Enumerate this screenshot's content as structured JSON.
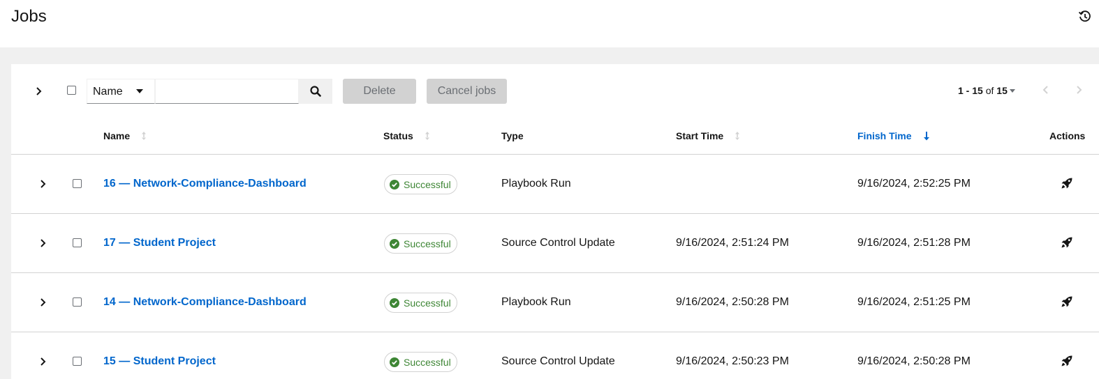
{
  "header": {
    "title": "Jobs",
    "history_icon": "history-icon"
  },
  "toolbar": {
    "filter_select_value": "Name",
    "search_placeholder": "",
    "delete_label": "Delete",
    "cancel_label": "Cancel jobs",
    "pagination": {
      "range": "1 - 15",
      "of_label": "of",
      "total": "15"
    }
  },
  "table": {
    "columns": {
      "name": "Name",
      "status": "Status",
      "type": "Type",
      "start": "Start Time",
      "finish": "Finish Time",
      "actions": "Actions"
    },
    "sorted_column": "Finish Time",
    "sort_direction": "descending",
    "rows": [
      {
        "name": "16 — Network-Compliance-Dashboard",
        "status": "Successful",
        "type": "Playbook Run",
        "start": "",
        "finish": "9/16/2024, 2:52:25 PM"
      },
      {
        "name": "17 — Student Project",
        "status": "Successful",
        "type": "Source Control Update",
        "start": "9/16/2024, 2:51:24 PM",
        "finish": "9/16/2024, 2:51:28 PM"
      },
      {
        "name": "14 — Network-Compliance-Dashboard",
        "status": "Successful",
        "type": "Playbook Run",
        "start": "9/16/2024, 2:50:28 PM",
        "finish": "9/16/2024, 2:51:25 PM"
      },
      {
        "name": "15 — Student Project",
        "status": "Successful",
        "type": "Source Control Update",
        "start": "9/16/2024, 2:50:23 PM",
        "finish": "9/16/2024, 2:50:28 PM"
      }
    ]
  },
  "colors": {
    "link": "#0066cc",
    "success": "#3e8635",
    "page_bg": "#f0f0f0",
    "disabled_button": "#d2d2d2"
  }
}
